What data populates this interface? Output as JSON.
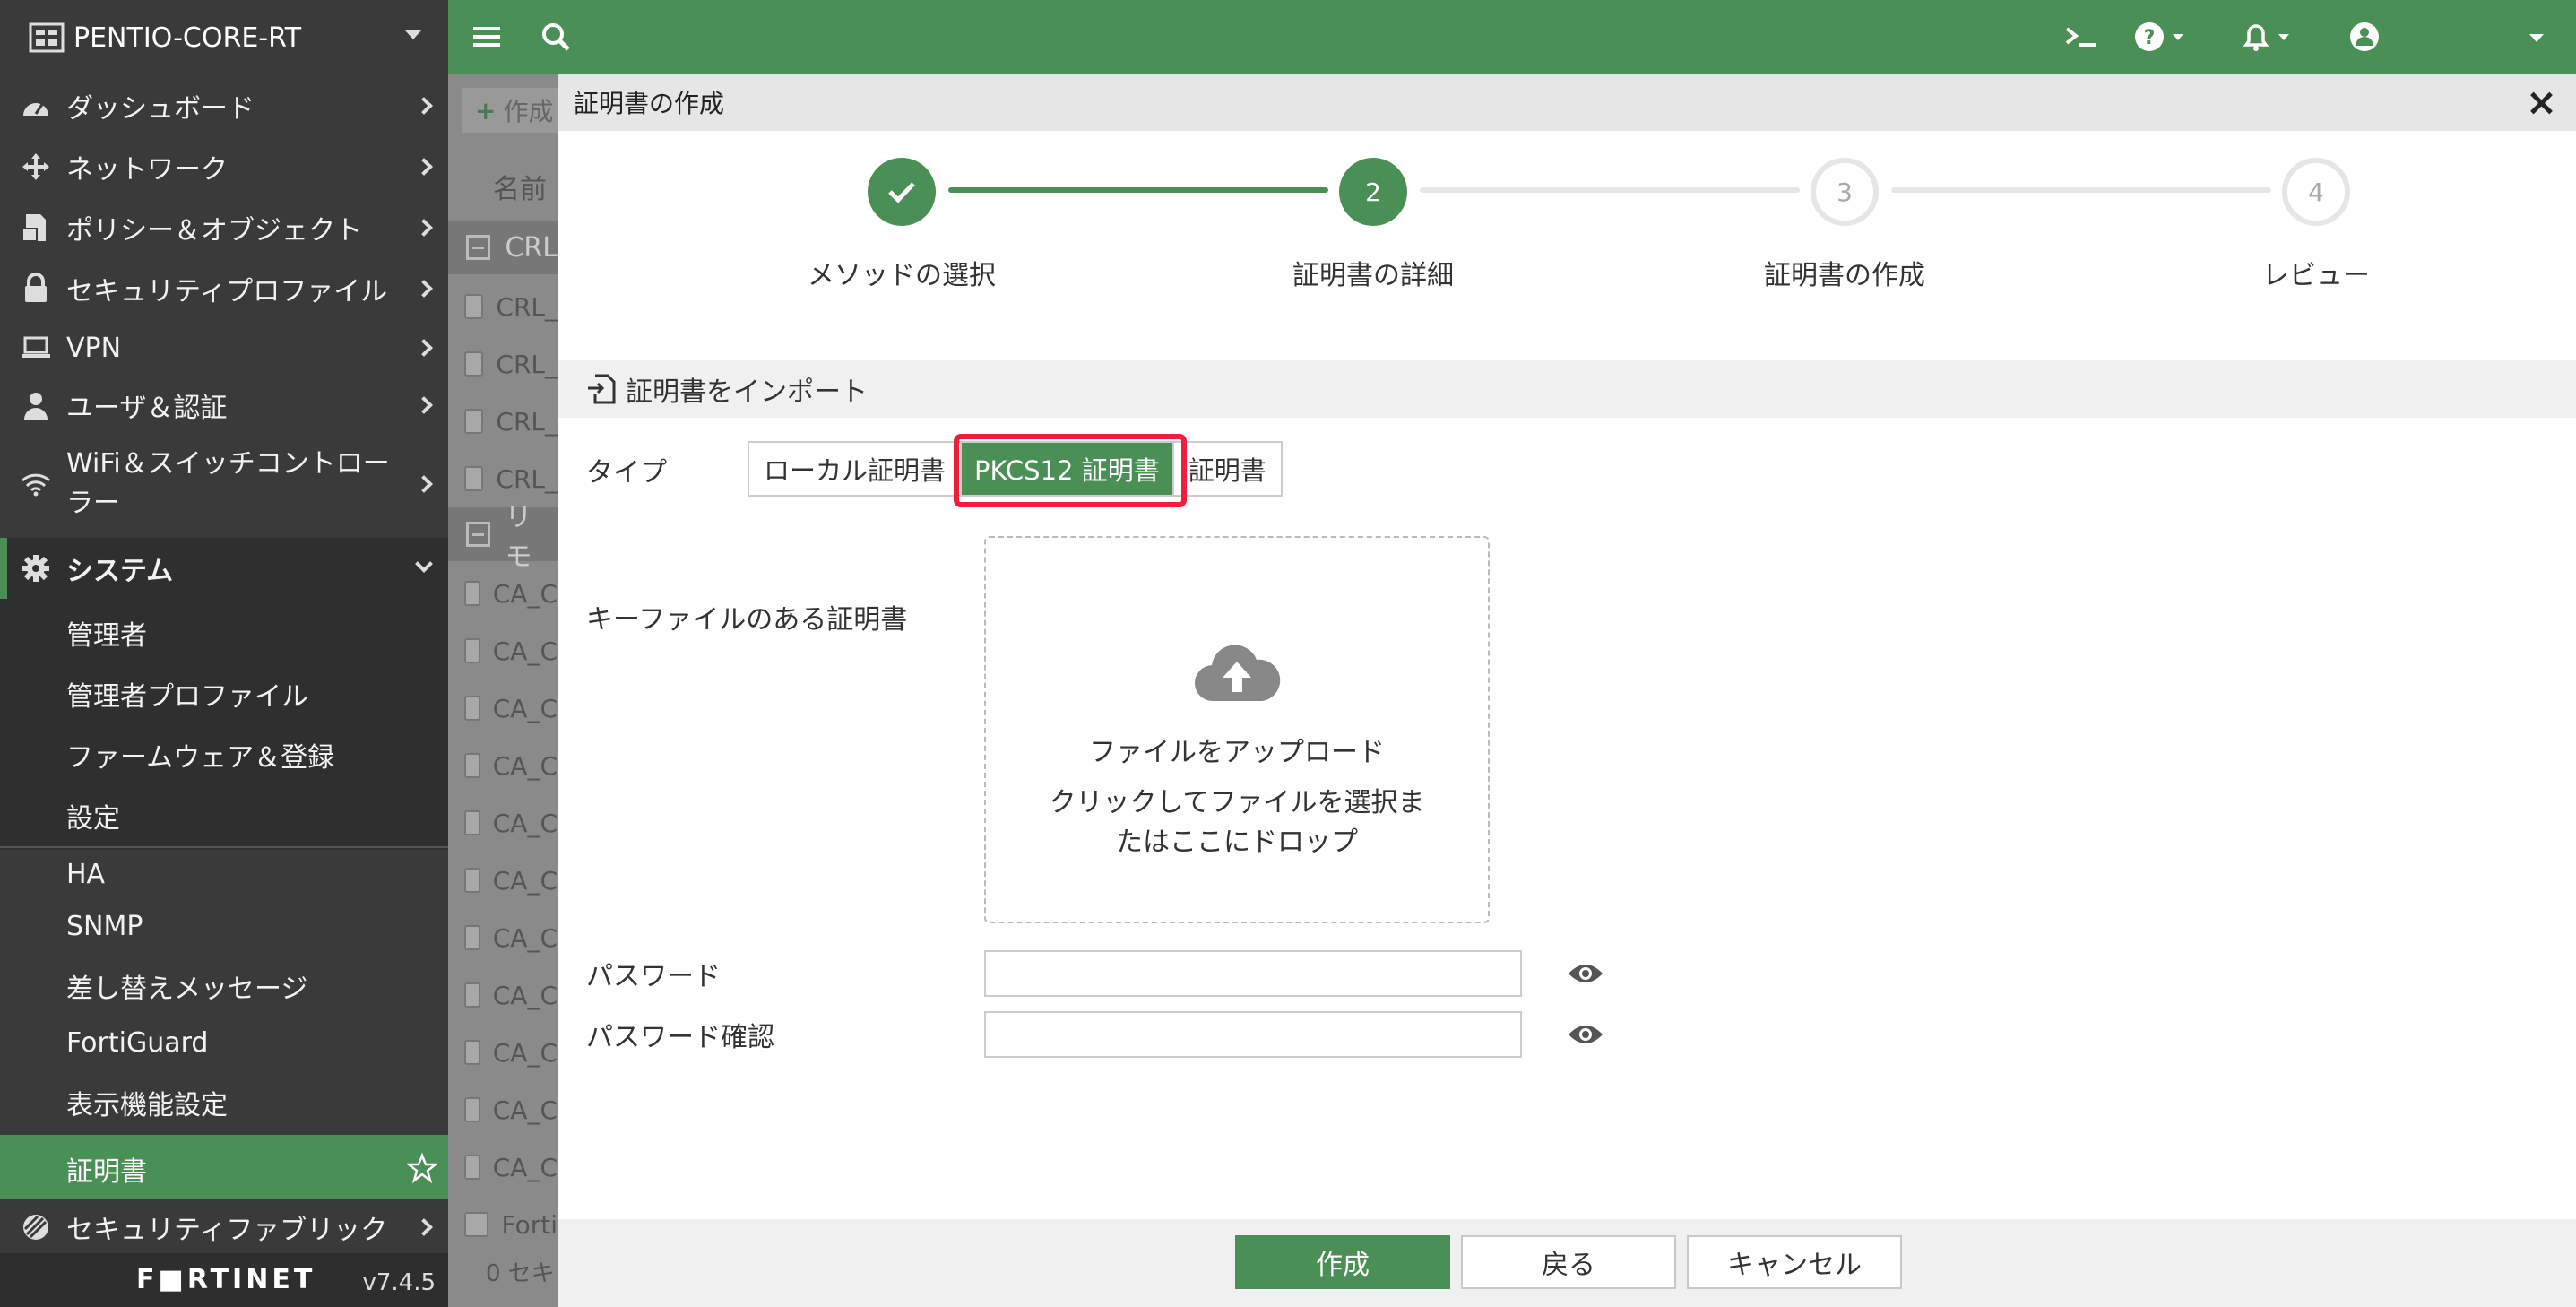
{
  "device": {
    "name": "PENTIO-CORE-RT"
  },
  "sidebar": {
    "items": [
      {
        "label": "ダッシュボード",
        "icon": "dashboard-icon"
      },
      {
        "label": "ネットワーク",
        "icon": "network-icon"
      },
      {
        "label": "ポリシー＆オブジェクト",
        "icon": "policy-icon"
      },
      {
        "label": "セキュリティプロファイル",
        "icon": "lock-icon"
      },
      {
        "label": "VPN",
        "icon": "laptop-icon"
      },
      {
        "label": "ユーザ＆認証",
        "icon": "user-icon"
      },
      {
        "label": "WiFi＆スイッチコントローラー",
        "label_line1": "WiFi＆スイッチコントロー",
        "label_line2": "ラー",
        "icon": "wifi-icon"
      },
      {
        "label": "システム",
        "icon": "gear-icon"
      },
      {
        "label": "セキュリティファブリック",
        "icon": "fabric-icon"
      }
    ],
    "system_sub": [
      "管理者",
      "管理者プロファイル",
      "ファームウェア＆登録",
      "設定",
      "HA",
      "SNMP",
      "差し替えメッセージ",
      "FortiGuard",
      "表示機能設定",
      "証明書"
    ],
    "logo": "F■RTINET",
    "version": "v7.4.5"
  },
  "topbar": {
    "icons": [
      "menu-icon",
      "search-icon",
      "cli-icon",
      "help-icon",
      "bell-icon",
      "user-account-icon"
    ]
  },
  "background_list": {
    "toolbar_create": "作成",
    "header_name": "名前",
    "group1": "CRL",
    "rows1": [
      "CRL_",
      "CRL_",
      "CRL_",
      "CRL_"
    ],
    "group2": "リモ",
    "rows2": [
      "CA_C",
      "CA_C",
      "CA_C",
      "CA_C",
      "CA_C",
      "CA_C",
      "CA_C",
      "CA_C",
      "CA_C",
      "CA_C",
      "CA_C",
      "Forti"
    ],
    "footer": "0  セキ"
  },
  "modal": {
    "title": "証明書の作成",
    "steps": [
      {
        "label": "メソッドの選択",
        "num": ""
      },
      {
        "label": "証明書の詳細",
        "num": "2"
      },
      {
        "label": "証明書の作成",
        "num": "3"
      },
      {
        "label": "レビュー",
        "num": "4"
      }
    ],
    "section_title": "証明書をインポート",
    "type_label": "タイプ",
    "type_options": [
      "ローカル証明書",
      "PKCS12 証明書",
      "証明書"
    ],
    "type_selected": "PKCS12 証明書",
    "keyfile_label": "キーファイルのある証明書",
    "upload_title": "ファイルをアップロード",
    "upload_sub": "クリックしてファイルを選択またはここにドロップ",
    "password_label": "パスワード",
    "password_confirm_label": "パスワード確認",
    "buttons": {
      "create": "作成",
      "back": "戻る",
      "cancel": "キャンセル"
    }
  },
  "colors": {
    "accent": "#4a8f55",
    "sidebar": "#3a3a3a",
    "highlight": "#ee1f3c"
  }
}
